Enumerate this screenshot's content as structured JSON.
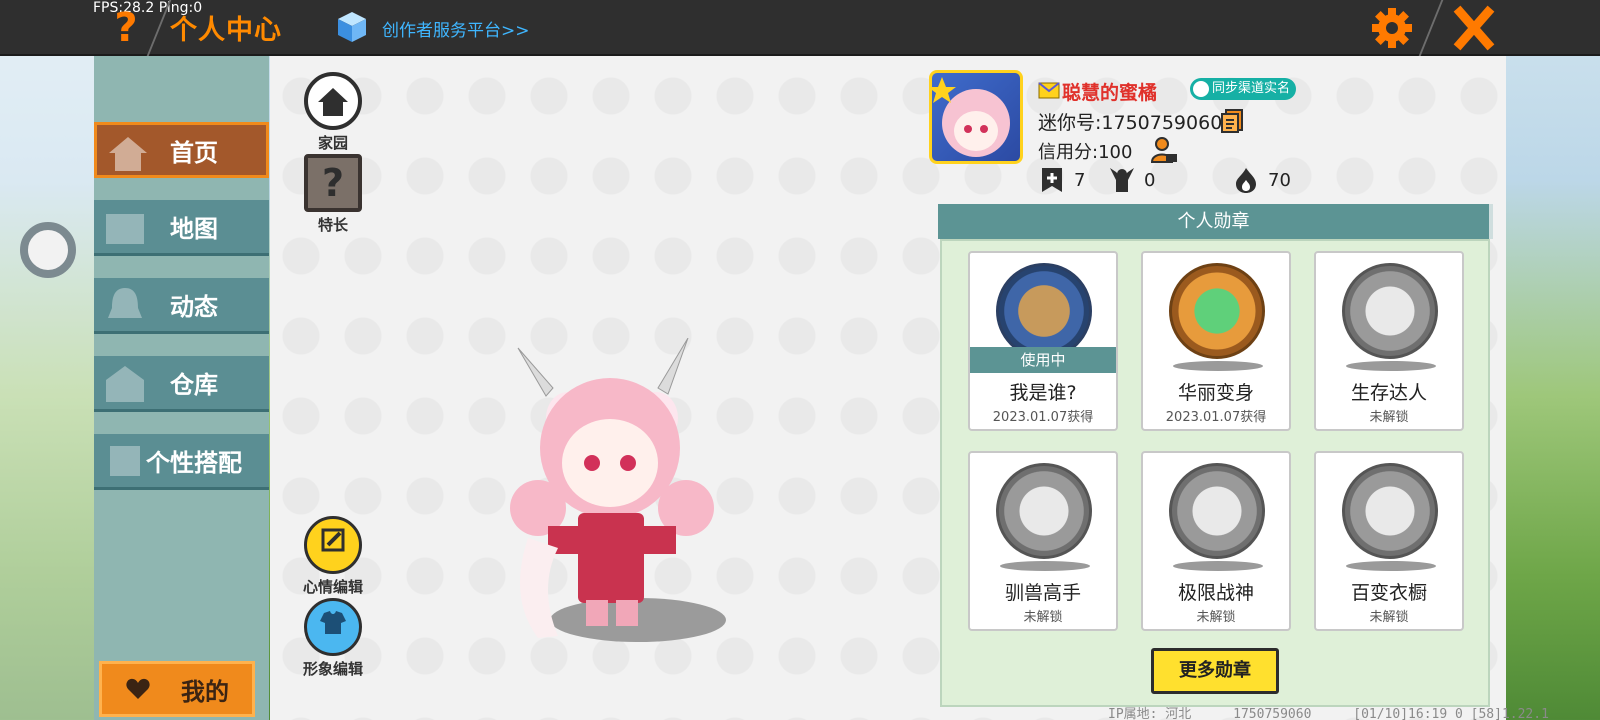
{
  "topbar": {
    "fps": "FPS:28.2  Ping:0",
    "help_icon": "question-icon",
    "title": "个人中心",
    "creator_link": "创作者服务平台>>",
    "settings_icon": "gear-icon",
    "close_icon": "close-icon"
  },
  "sidebar": {
    "items": [
      {
        "label": "首页",
        "icon": "house-icon"
      },
      {
        "label": "地图",
        "icon": "image-icon"
      },
      {
        "label": "动态",
        "icon": "bell-icon"
      },
      {
        "label": "仓库",
        "icon": "warehouse-icon"
      },
      {
        "label": "个性搭配",
        "icon": "character-icon"
      }
    ],
    "mine_label": "我的"
  },
  "left_actions": {
    "home": "家园",
    "specialty": "特长",
    "mood_edit": "心情编辑",
    "look_edit": "形象编辑"
  },
  "profile": {
    "name": "聪慧的蜜橘",
    "sync_badge": "同步渠道实名",
    "mini_id": "迷你号:1750759060",
    "credit": "信用分:100",
    "stats": {
      "likes": "7",
      "fans": "0",
      "heat": "70"
    }
  },
  "medals": {
    "header": "个人勋章",
    "in_use_label": "使用中",
    "items": [
      {
        "name": "我是谁?",
        "sub": "2023.01.07获得",
        "style": "blue",
        "in_use": true
      },
      {
        "name": "华丽变身",
        "sub": "2023.01.07获得",
        "style": "bronze",
        "in_use": false
      },
      {
        "name": "生存达人",
        "sub": "未解锁",
        "style": "gray",
        "in_use": false
      },
      {
        "name": "驯兽高手",
        "sub": "未解锁",
        "style": "gray",
        "in_use": false
      },
      {
        "name": "极限战神",
        "sub": "未解锁",
        "style": "gray",
        "in_use": false
      },
      {
        "name": "百变衣橱",
        "sub": "未解锁",
        "style": "gray",
        "in_use": false
      }
    ],
    "more_button": "更多勋章"
  },
  "footer": {
    "ip_location": "IP属地: 河北",
    "id": "1750759060",
    "session": "[01/10]16:19 0 [58]1.22.1"
  },
  "colors": {
    "accent_orange": "#f08a1c",
    "teal": "#5c9494",
    "name_red": "#e0312b",
    "yellow": "#ffe02e"
  }
}
